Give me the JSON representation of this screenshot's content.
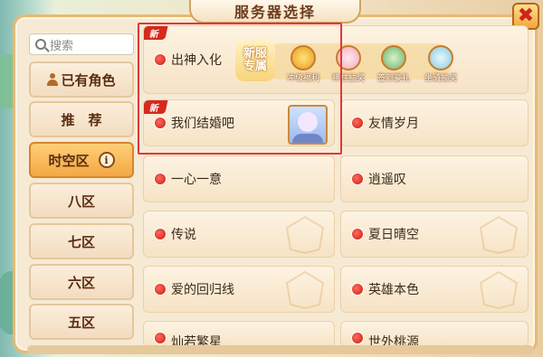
{
  "title": "服务器选择",
  "close_label": "✖",
  "search": {
    "placeholder": "搜索"
  },
  "sidebar": {
    "items": [
      {
        "label": "已有角色"
      },
      {
        "label": "推　荐"
      },
      {
        "label": "时空区",
        "active": true
      },
      {
        "label": "八区"
      },
      {
        "label": "七区"
      },
      {
        "label": "六区"
      },
      {
        "label": "五区"
      }
    ],
    "info_glyph": "i"
  },
  "new_ribbon": "新",
  "promo": {
    "badge": "新服专属",
    "features": [
      {
        "label": "冲级福利",
        "icon": "coin-icon"
      },
      {
        "label": "神柱抽奖",
        "icon": "character-icon"
      },
      {
        "label": "签到豪礼",
        "icon": "warrior-icon"
      },
      {
        "label": "坐骑抽奖",
        "icon": "mount-icon"
      }
    ]
  },
  "servers": [
    {
      "name": "出神入化",
      "is_new": true
    },
    {
      "name": "我们结婚吧",
      "is_new": true
    },
    {
      "name": "友情岁月"
    },
    {
      "name": "一心一意"
    },
    {
      "name": "逍遥叹"
    },
    {
      "name": "传说"
    },
    {
      "name": "夏日晴空"
    },
    {
      "name": "爱的回归线"
    },
    {
      "name": "英雄本色"
    },
    {
      "name": "灿若繁星"
    },
    {
      "name": "世外桃源"
    }
  ],
  "colors": {
    "status_dot": "#d0241a",
    "highlight": "#e0383a",
    "ribbon": "#d52a1d",
    "active_tab": "#f3a844"
  }
}
